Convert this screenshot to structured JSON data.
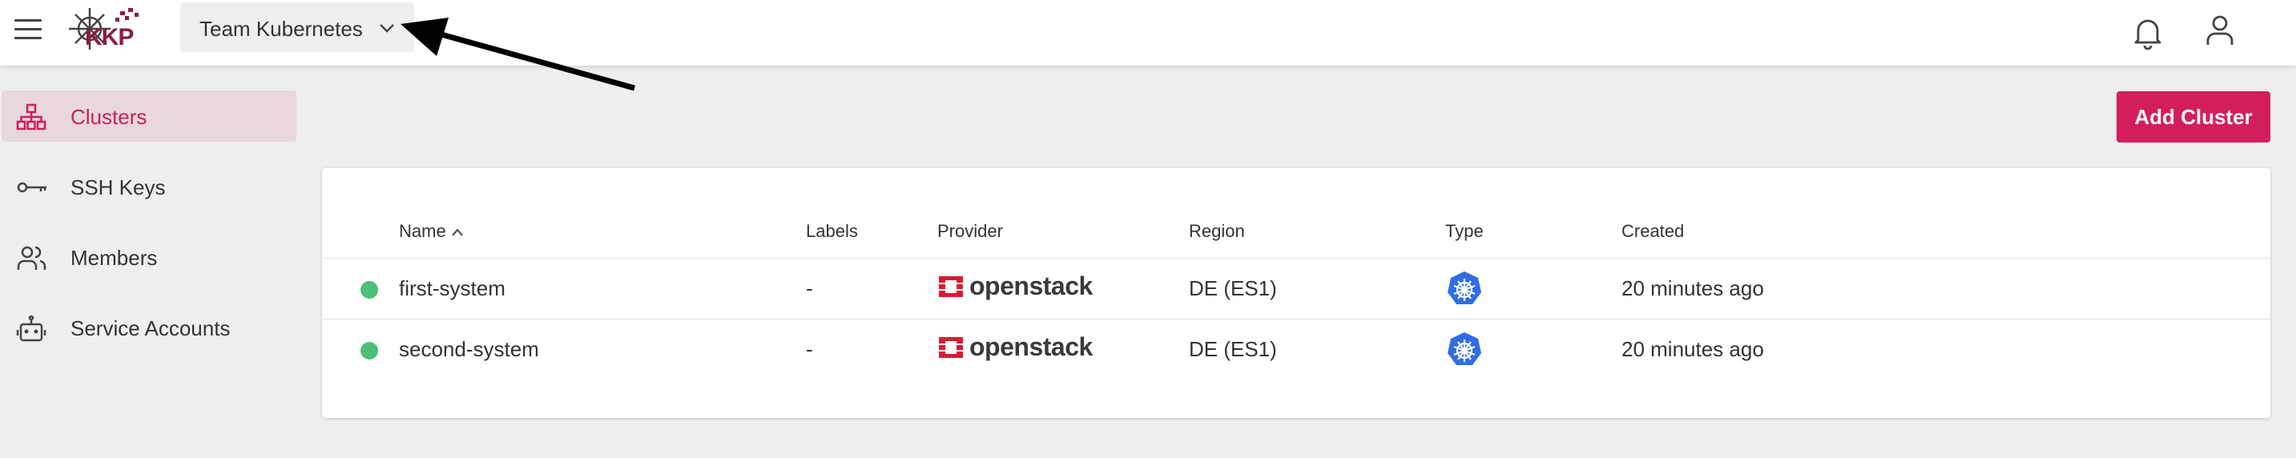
{
  "header": {
    "logo_text": "KKP",
    "project_selector": {
      "value": "Team Kubernetes"
    }
  },
  "sidebar": {
    "items": [
      {
        "label": "Clusters",
        "icon": "sitemap-icon",
        "active": true
      },
      {
        "label": "SSH Keys",
        "icon": "key-icon",
        "active": false
      },
      {
        "label": "Members",
        "icon": "users-icon",
        "active": false
      },
      {
        "label": "Service Accounts",
        "icon": "robot-icon",
        "active": false
      }
    ]
  },
  "main": {
    "add_cluster_label": "Add Cluster",
    "table": {
      "columns": [
        "Name",
        "Labels",
        "Provider",
        "Region",
        "Type",
        "Created"
      ],
      "rows": [
        {
          "name": "first-system",
          "labels": "-",
          "provider": "openstack",
          "region": "DE (ES1)",
          "type": "kubernetes-icon",
          "created": "20 minutes ago",
          "status": "healthy"
        },
        {
          "name": "second-system",
          "labels": "-",
          "provider": "openstack",
          "region": "DE (ES1)",
          "type": "kubernetes-icon",
          "created": "20 minutes ago",
          "status": "healthy"
        }
      ]
    }
  },
  "colors": {
    "accent": "#d41e5c",
    "active_nav_bg": "#e8d7dc",
    "active_nav_text": "#c8215e",
    "status_ok": "#4cbf7a",
    "openstack_red": "#da1a32",
    "kubernetes_blue": "#326ce5"
  }
}
